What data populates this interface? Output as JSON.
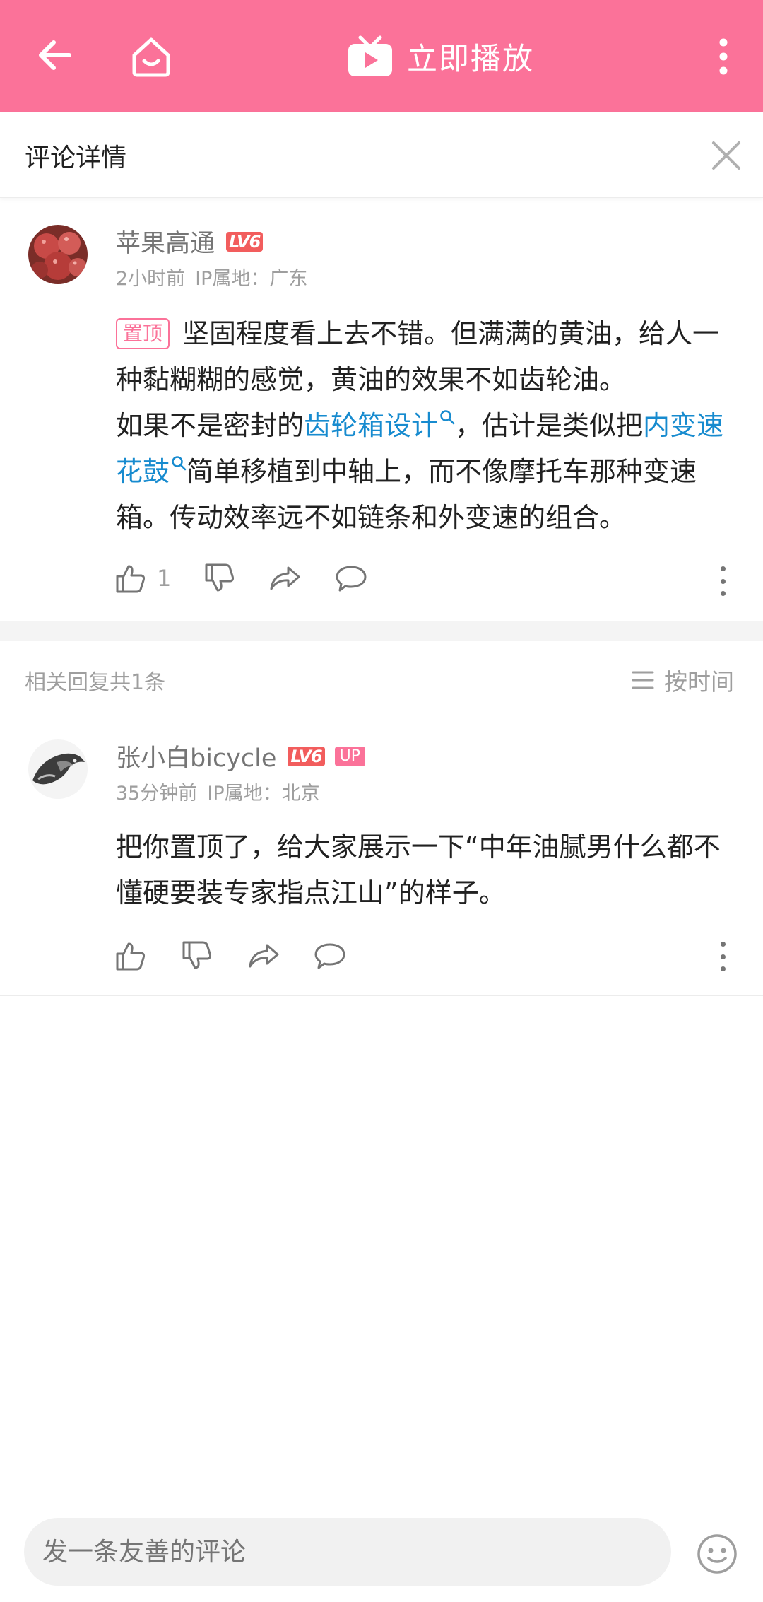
{
  "topbar": {
    "play_label": "立即播放",
    "icons": [
      "back-arrow-icon",
      "home-icon",
      "tv-play-icon",
      "more-vertical-icon"
    ],
    "bg_color": "#fb7299"
  },
  "panel": {
    "title": "评论详情"
  },
  "main_comment": {
    "username": "苹果高通",
    "level": "LV6",
    "time": "2小时前",
    "ip": "IP属地：广东",
    "pinned_label": "置顶",
    "text_1": "坚固程度看上去不错。但满满的黄油，给人一种黏糊糊的感觉，黄油的效果不如齿轮油。",
    "text_2a": "如果不是密封的",
    "keyword_1": "齿轮箱设计",
    "text_2b": "，估计是类似把",
    "keyword_2": "内变速花鼓",
    "text_2c": "简单移植到中轴上，而不像摩托车那种变速箱。传动效率远不如链条和外变速的组合。",
    "like_count": "1"
  },
  "replies": {
    "count_label": "相关回复共1条",
    "sort_label": "按时间"
  },
  "reply": {
    "username": "张小白bicycle",
    "level": "LV6",
    "up_badge": "UP",
    "time": "35分钟前",
    "ip": "IP属地：北京",
    "text": "把你置顶了，给大家展示一下“中年油腻男什么都不懂硬要装专家指点江山”的样子。"
  },
  "bottom": {
    "placeholder": "发一条友善的评论"
  },
  "colors": {
    "accent": "#fb7299",
    "link": "#178bcf",
    "level_badge": "#f25d5d"
  }
}
